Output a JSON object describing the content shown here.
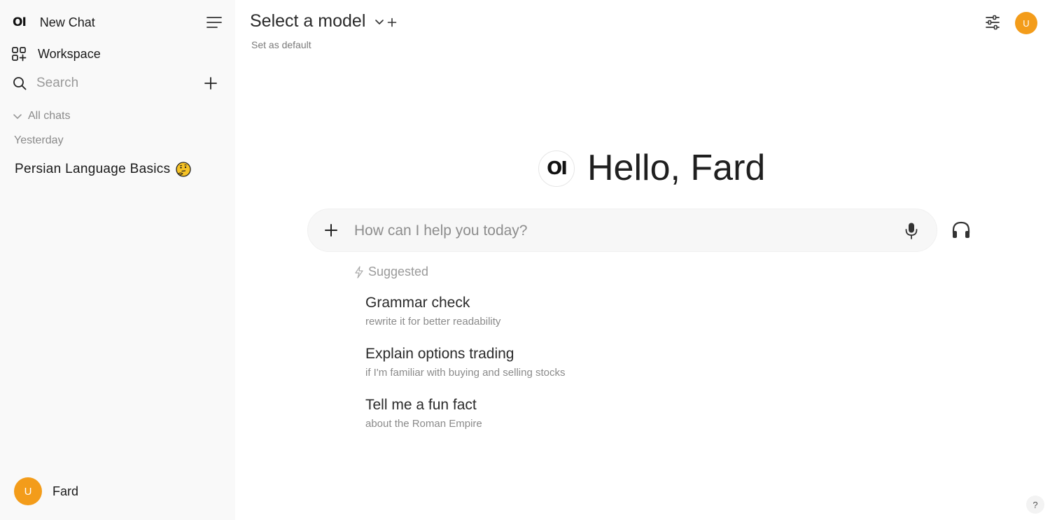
{
  "sidebar": {
    "logo_text": "OI",
    "new_chat_label": "New Chat",
    "workspace_label": "Workspace",
    "search_placeholder": "Search",
    "folder_label": "All chats",
    "groups": [
      {
        "label": "Yesterday",
        "chats": [
          {
            "title": "Persian Language Basics",
            "emoji": "thinking-face"
          }
        ]
      }
    ],
    "user": {
      "initial": "U",
      "name": "Fard"
    }
  },
  "header": {
    "model_selector_label": "Select a model",
    "set_default_label": "Set as default",
    "user_initial": "U"
  },
  "main": {
    "logo_text": "OI",
    "greeting": "Hello, Fard",
    "prompt_placeholder": "How can I help you today?",
    "suggested_label": "Suggested",
    "suggestions": [
      {
        "title": "Grammar check",
        "subtitle": "rewrite it for better readability"
      },
      {
        "title": "Explain options trading",
        "subtitle": "if I'm familiar with buying and selling stocks"
      },
      {
        "title": "Tell me a fun fact",
        "subtitle": "about the Roman Empire"
      }
    ],
    "help_label": "?"
  },
  "colors": {
    "avatar": "#f39c1a",
    "sidebar_bg": "#f9f9f9",
    "prompt_bg": "#f7f7f7"
  }
}
